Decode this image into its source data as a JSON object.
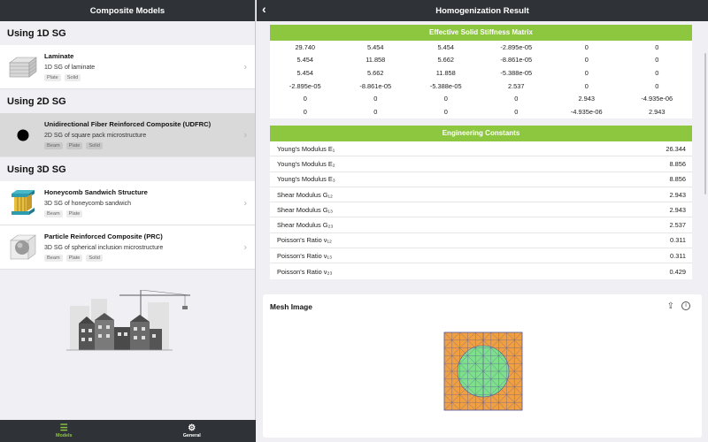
{
  "left": {
    "title": "Composite Models",
    "sections": [
      {
        "header": "Using 1D SG",
        "items": [
          {
            "title": "Laminate",
            "desc": "1D SG of laminate",
            "tags": [
              "Plate",
              "Solid"
            ],
            "icon": "laminate-icon"
          }
        ]
      },
      {
        "header": "Using 2D SG",
        "items": [
          {
            "title": "Unidirectional Fiber Reinforced Composite (UDFRC)",
            "desc": "2D SG of square pack microstructure",
            "tags": [
              "Beam",
              "Plate",
              "Solid"
            ],
            "icon": "fiber-icon",
            "selected": true
          }
        ]
      },
      {
        "header": "Using 3D SG",
        "items": [
          {
            "title": "Honeycomb Sandwich Structure",
            "desc": "3D SG of honeycomb sandwich",
            "tags": [
              "Beam",
              "Plate"
            ],
            "icon": "honeycomb-icon"
          },
          {
            "title": "Particle Reinforced Composite (PRC)",
            "desc": "3D SG of spherical inclusion microstructure",
            "tags": [
              "Beam",
              "Plate",
              "Solid"
            ],
            "icon": "particle-icon"
          }
        ]
      }
    ],
    "tabs": [
      {
        "label": "Models",
        "icon": "list-icon",
        "active": true
      },
      {
        "label": "General",
        "icon": "gear-icon",
        "active": false
      }
    ]
  },
  "right": {
    "title": "Homogenization Result",
    "matrix": {
      "header": "Effective Solid Stiffness Matrix",
      "rows": [
        [
          "29.740",
          "5.454",
          "5.454",
          "-2.895e-05",
          "0",
          "0"
        ],
        [
          "5.454",
          "11.858",
          "5.662",
          "-8.861e-05",
          "0",
          "0"
        ],
        [
          "5.454",
          "5.662",
          "11.858",
          "-5.388e-05",
          "0",
          "0"
        ],
        [
          "-2.895e-05",
          "-8.861e-05",
          "-5.388e-05",
          "2.537",
          "0",
          "0"
        ],
        [
          "0",
          "0",
          "0",
          "0",
          "2.943",
          "-4.935e-06"
        ],
        [
          "0",
          "0",
          "0",
          "0",
          "-4.935e-06",
          "2.943"
        ]
      ]
    },
    "engineering": {
      "header": "Engineering Constants",
      "rows": [
        {
          "label": "Young's Modulus E₁",
          "value": "26.344"
        },
        {
          "label": "Young's Modulus E₂",
          "value": "8.856"
        },
        {
          "label": "Young's Modulus E₃",
          "value": "8.856"
        },
        {
          "label": "Shear Modulus G₁₂",
          "value": "2.943"
        },
        {
          "label": "Shear Modulus G₁₃",
          "value": "2.943"
        },
        {
          "label": "Shear Modulus G₂₃",
          "value": "2.537"
        },
        {
          "label": "Poisson's Ratio ν₁₂",
          "value": "0.311"
        },
        {
          "label": "Poisson's Ratio ν₁₃",
          "value": "0.311"
        },
        {
          "label": "Poisson's Ratio ν₂₃",
          "value": "0.429"
        }
      ]
    },
    "mesh": {
      "title": "Mesh Image",
      "matrix_color": "#f0a040",
      "fiber_color": "#7ee08a",
      "edge_color": "#5a5aa0"
    }
  }
}
